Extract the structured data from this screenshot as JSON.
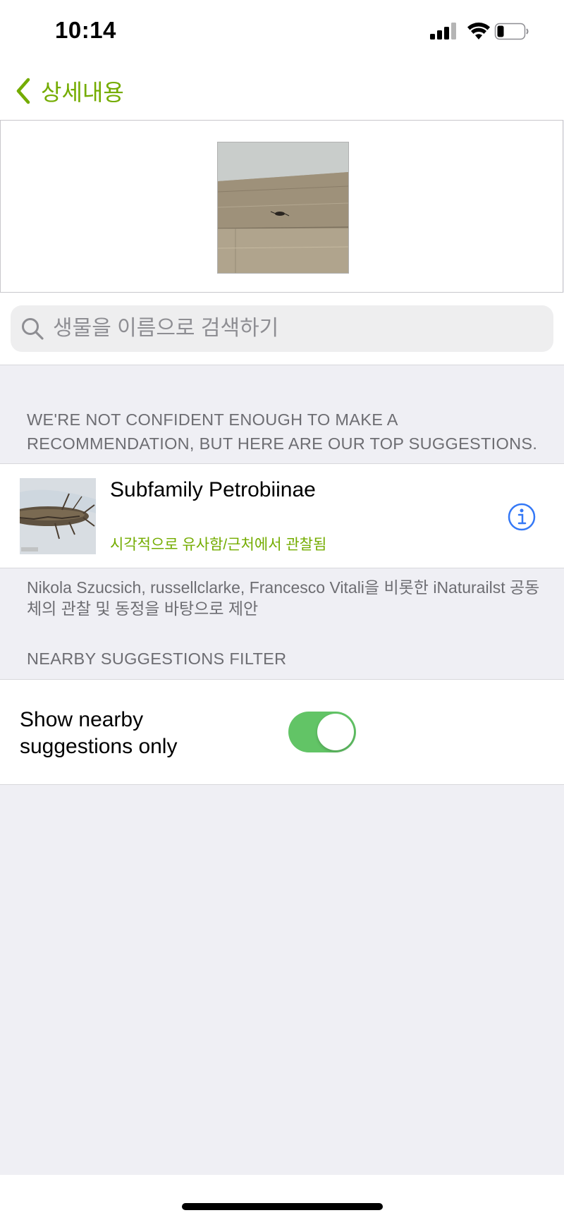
{
  "status_bar": {
    "time": "10:14"
  },
  "nav": {
    "back_label": "상세내용"
  },
  "search": {
    "placeholder": "생물을 이름으로 검색하기"
  },
  "suggestions": {
    "header": "WE'RE NOT CONFIDENT ENOUGH TO MAKE A RECOMMENDATION, BUT HERE ARE OUR TOP SUGGESTIONS.",
    "items": [
      {
        "name": "Subfamily Petrobiinae",
        "reason": "시각적으로 유사함/근처에서 관찰됨"
      }
    ],
    "attribution": " Nikola Szucsich, russellclarke, Francesco Vitali을 비롯한 iNaturailst 공동체의 관찰 및 동정을 바탕으로 제안"
  },
  "filter": {
    "header": "NEARBY SUGGESTIONS FILTER",
    "label": "Show nearby suggestions only",
    "enabled": true
  },
  "colors": {
    "accent": "#74ac00",
    "toggle_on": "#62c466",
    "info_blue": "#3478f6",
    "background": "#efeff4"
  }
}
